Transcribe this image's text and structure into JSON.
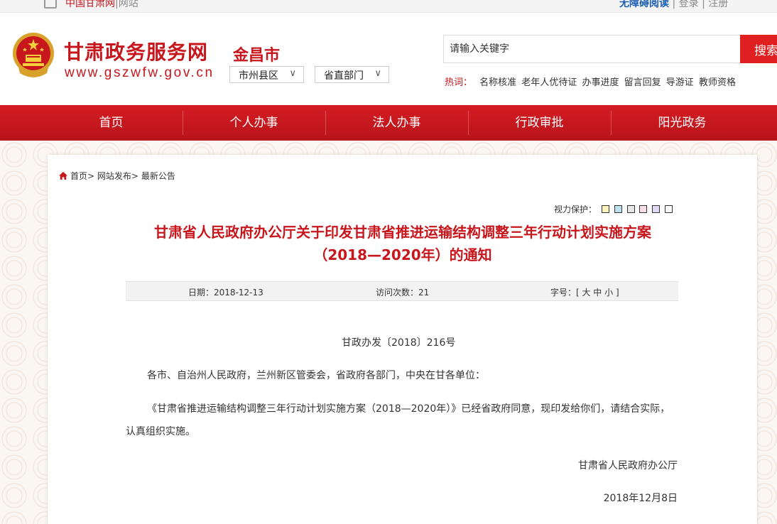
{
  "topbar": {
    "left_link_1": "中国甘肃网",
    "left_link_2": "网站",
    "accessibility": "无障碍阅读",
    "login": "登录",
    "register": "注册",
    "separator": "|"
  },
  "header": {
    "logo_text": "甘肃政务服务网",
    "logo_url": "www.gszwfw.gov.cn",
    "city": "金昌市",
    "select_city": "市州县区",
    "select_dept": "省直部门",
    "search_placeholder": "请输入关键字",
    "search_button": "搜索",
    "hot_label": "热词：",
    "hot_words": [
      "名称核准",
      "老年人优待证",
      "办事进度",
      "留言回复",
      "导游证",
      "教师资格"
    ]
  },
  "nav": {
    "items": [
      "首页",
      "个人办事",
      "法人办事",
      "行政审批",
      "阳光政务"
    ]
  },
  "breadcrumb": {
    "items": [
      "首页",
      "网站发布",
      "最新公告"
    ],
    "sep": ">"
  },
  "article": {
    "vision_label": "视力保护：",
    "vision_colors": [
      "#fbf2bd",
      "#bfe0ef",
      "#e6e6e6",
      "#f7dde6",
      "#e1d8f4",
      "#ffffff"
    ],
    "title_line1": "甘肃省人民政府办公厅关于印发甘肃省推进运输结构调整三年行动计划实施方案",
    "title_line2": "（2018—2020年）的通知",
    "date": "日期：2018-12-13",
    "visits": "访问次数：21",
    "font_size": "字号：[ 大 中 小 ]",
    "doc_number": "甘政办发〔2018〕216号",
    "addressees": "各市、自治州人民政府，兰州新区管委会，省政府各部门，中央在甘各单位：",
    "body": "《甘肃省推进运输结构调整三年行动计划实施方案（2018—2020年）》已经省政府同意，现印发给你们，请结合实际，认真组织实施。",
    "signature": "甘肃省人民政府办公厅",
    "sign_date": "2018年12月8日"
  }
}
